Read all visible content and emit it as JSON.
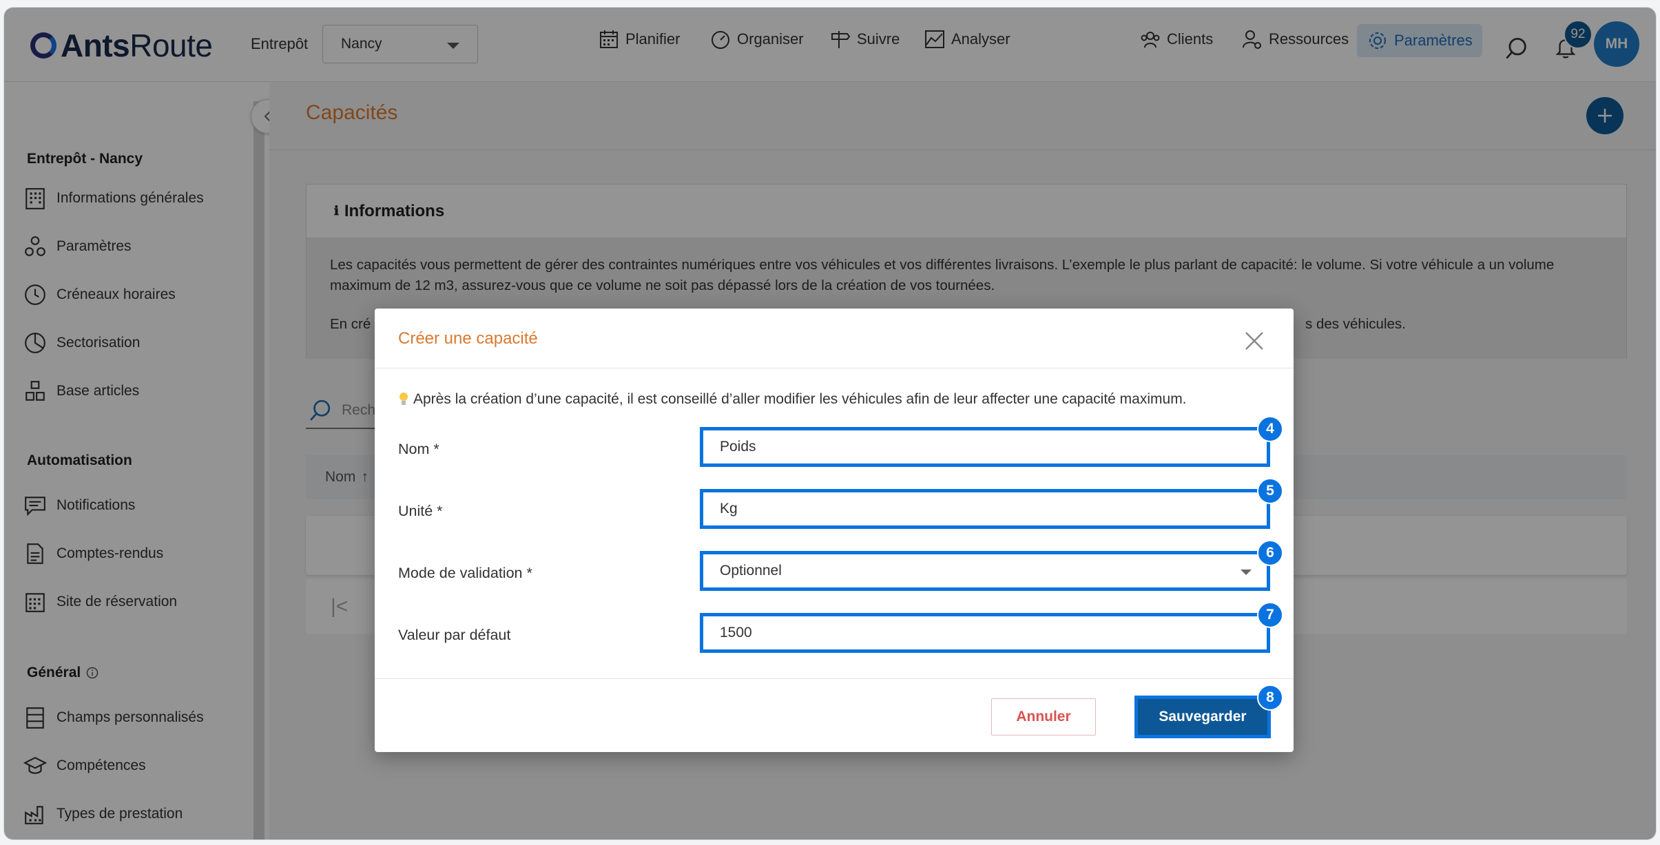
{
  "app": {
    "logo_bold": "Ants",
    "logo_rest": "Route"
  },
  "header": {
    "warehouse_label": "Entrepôt",
    "warehouse_value": "Nancy",
    "nav": [
      {
        "label": "Planifier",
        "icon": "calendar-icon"
      },
      {
        "label": "Organiser",
        "icon": "gauge-icon"
      },
      {
        "label": "Suivre",
        "icon": "signpost-icon"
      },
      {
        "label": "Analyser",
        "icon": "chart-icon"
      },
      {
        "label": "Clients",
        "icon": "users-icon"
      },
      {
        "label": "Ressources",
        "icon": "user-gear-icon"
      },
      {
        "label": "Paramètres",
        "icon": "gear-icon",
        "active": true
      }
    ],
    "notifications_count": "92",
    "avatar_initials": "MH"
  },
  "sidebar": {
    "section1": "Entrepôt - Nancy",
    "items1": [
      "Informations générales",
      "Paramètres",
      "Créneaux horaires",
      "Sectorisation",
      "Base articles"
    ],
    "section2": "Automatisation",
    "items2": [
      "Notifications",
      "Comptes-rendus",
      "Site de réservation"
    ],
    "section3": "Général",
    "items3": [
      "Champs personnalisés",
      "Compétences",
      "Types de prestation"
    ]
  },
  "main": {
    "title": "Capacités",
    "info_title": "Informations",
    "info_text_1": "Les capacités vous permettent de gérer des contraintes numériques entre vos véhicules et vos différentes livraisons. L’exemple le plus parlant de capacité: le volume. Si votre véhicule a un volume maximum de 12 m3, assurez-vous que ce volume ne soit pas dépassé lors de la création de vos tournées.",
    "info_text_2_start": "En cré",
    "info_text_2_end": "s des véhicules.",
    "search_placeholder": "Rech",
    "table_col_name": "Nom",
    "pager_first": "|<"
  },
  "modal": {
    "title": "Créer une capacité",
    "tip": "Après la création d’une capacité, il est conseillé d’aller modifier les véhicules afin de leur affecter une capacité maximum.",
    "fields": [
      {
        "label": "Nom *",
        "value": "Poids",
        "marker": "4"
      },
      {
        "label": "Unité *",
        "value": "Kg",
        "marker": "5"
      },
      {
        "label": "Mode de validation *",
        "value": "Optionnel",
        "marker": "6"
      },
      {
        "label": "Valeur par défaut",
        "value": "1500",
        "marker": "7"
      }
    ],
    "cancel_label": "Annuler",
    "save_label": "Sauvegarder",
    "save_marker": "8"
  },
  "colors": {
    "accent": "#0a73e0",
    "primary_dark": "#0d5796",
    "title_orange": "#e07b28",
    "cancel_red": "#d9534f"
  }
}
